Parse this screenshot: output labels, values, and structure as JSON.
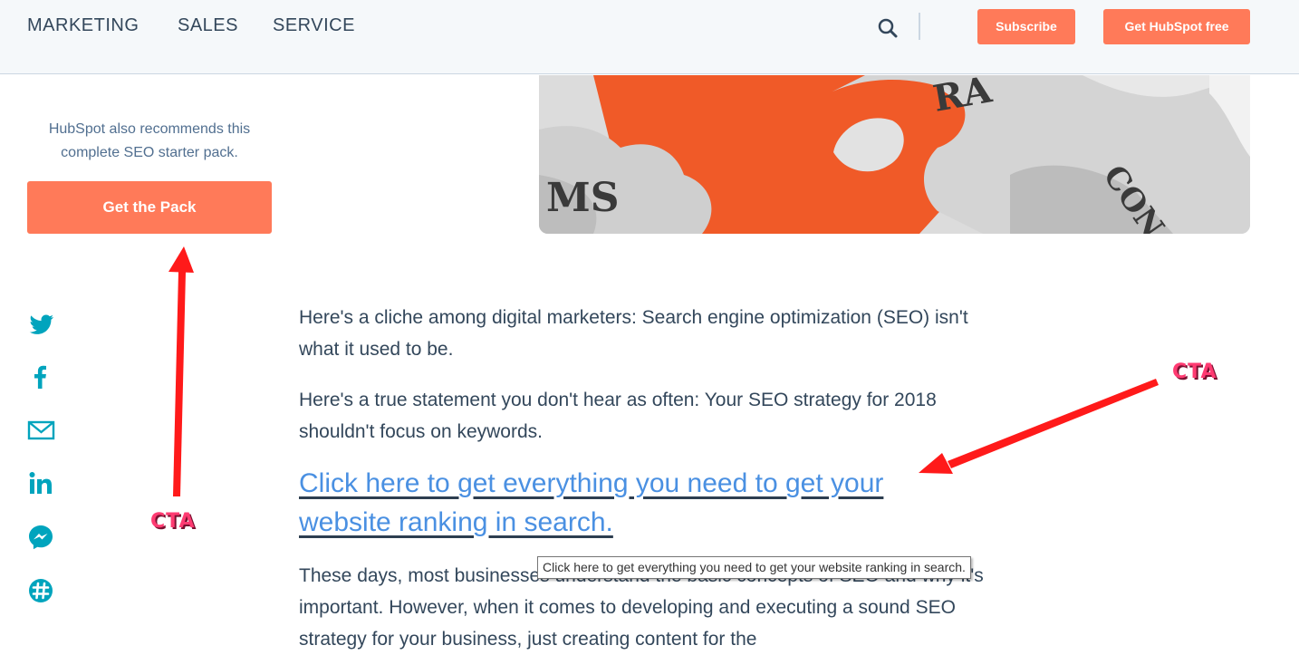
{
  "nav": {
    "items": [
      "MARKETING",
      "SALES",
      "SERVICE"
    ],
    "subscribe_label": "Subscribe",
    "get_free_label": "Get HubSpot free"
  },
  "sidebar": {
    "recommend_text": "HubSpot also recommends this complete SEO starter pack.",
    "pack_button_label": "Get the Pack",
    "share_icons": [
      "twitter-icon",
      "facebook-icon",
      "email-icon",
      "linkedin-icon",
      "messenger-icon",
      "slack-icon"
    ]
  },
  "hero": {
    "puzzle_text_left": "MS",
    "puzzle_text_top": "RA",
    "puzzle_text_right": "CON"
  },
  "article": {
    "p1": "Here's a cliche among digital marketers: Search engine optimization (SEO) isn't what it used to be.",
    "p2": "Here's a true statement you don't hear as often: Your SEO strategy for 2018 shouldn't focus on keywords.",
    "cta_link": "Click here to get everything you need to get your website ranking in search.",
    "p3": "These days, most businesses understand the basic concepts of SEO and why it's important. However, when it comes to developing and executing a sound SEO strategy for your business, just creating content for the"
  },
  "tooltip": "Click here to get everything you need to get your website ranking in search.",
  "annotations": {
    "left_label": "CTA",
    "right_label": "CTA"
  },
  "colors": {
    "accent": "#ff7a59",
    "link": "#4a90e2",
    "share": "#00a4bd",
    "annotation": "#ff3b72",
    "arrow": "#ff0000"
  }
}
